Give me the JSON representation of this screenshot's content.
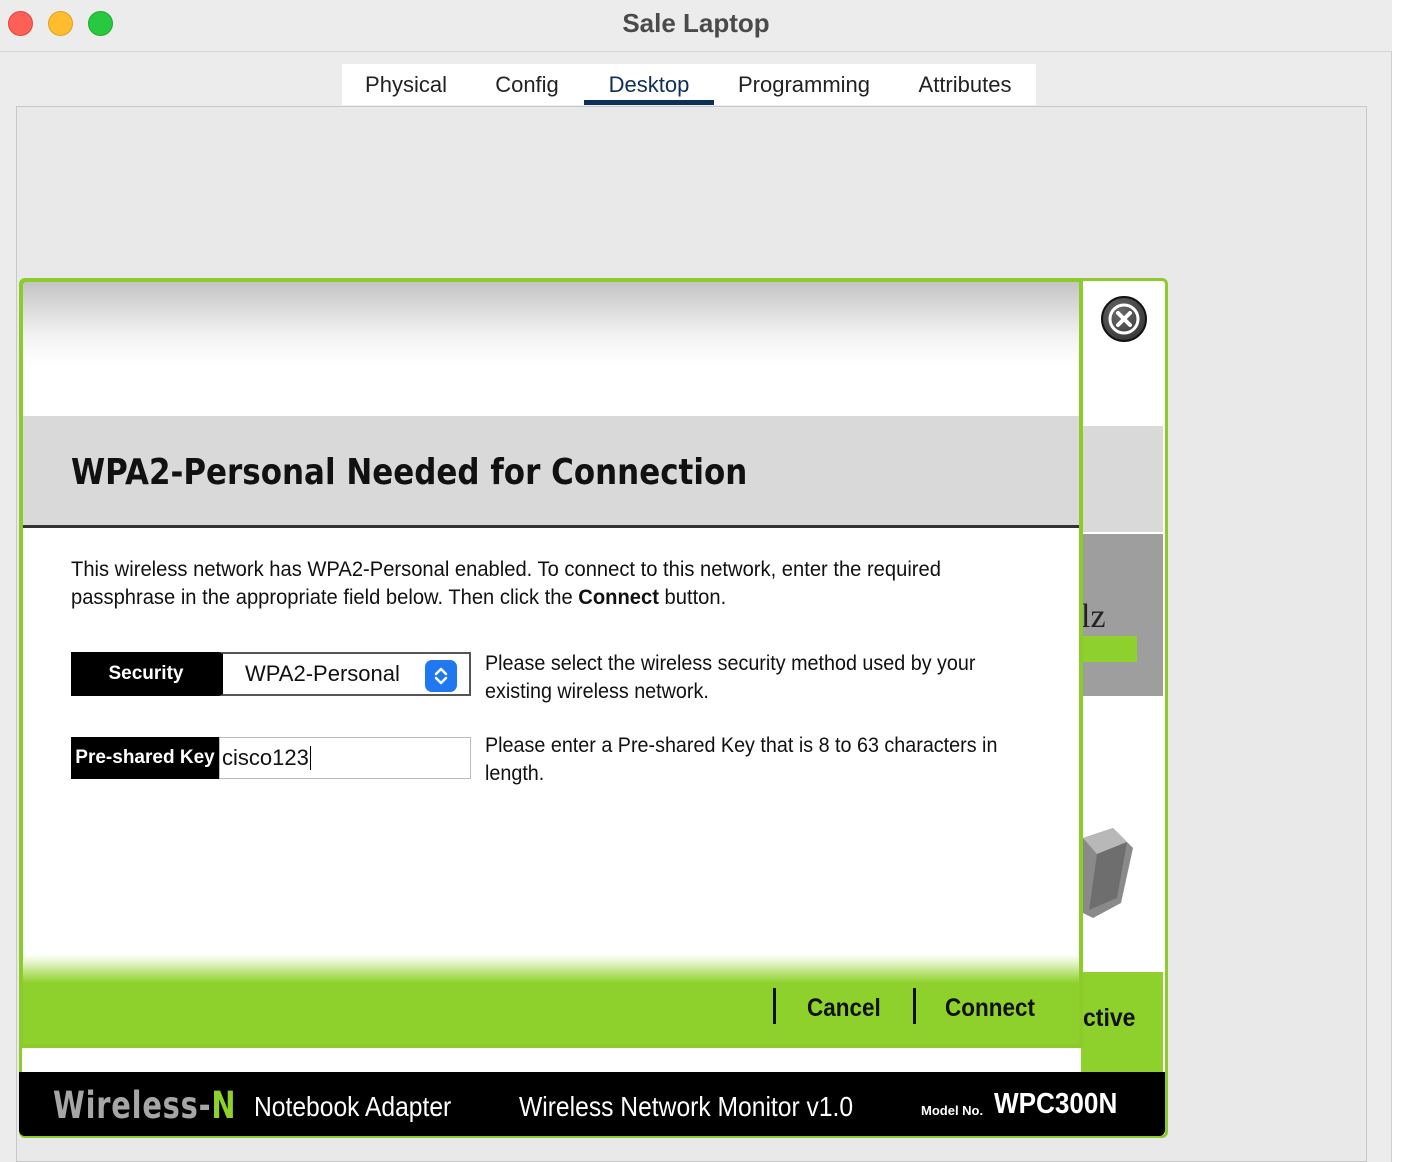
{
  "window": {
    "title": "Sale Laptop"
  },
  "tabs": [
    {
      "label": "Physical"
    },
    {
      "label": "Config"
    },
    {
      "label": "Desktop"
    },
    {
      "label": "Programming"
    },
    {
      "label": "Attributes"
    }
  ],
  "active_tab": "Desktop",
  "dialog": {
    "title": "WPA2-Personal Needed for Connection",
    "description_part1": "This wireless network has WPA2-Personal enabled. To connect to this network, enter the required passphrase in the appropriate field below. Then click the ",
    "description_bold": "Connect",
    "description_part2": " button.",
    "security": {
      "label": "Security",
      "value": "WPA2-Personal",
      "help": "Please select the wireless security method used by your existing wireless network."
    },
    "psk": {
      "label": "Pre-shared Key",
      "value": "cisco123",
      "help": "Please enter a Pre-shared Key that is 8 to 63 characters in length."
    },
    "cancel_label": "Cancel",
    "connect_label": "Connect"
  },
  "background_app": {
    "partial_label": "ctive",
    "partial_text": "lz"
  },
  "footer": {
    "brand_main": "Wireless-",
    "brand_accent": "N",
    "product": "Notebook Adapter",
    "monitor": "Wireless Network Monitor  v1.0",
    "model_label": "Model No.",
    "model": "WPC300N"
  },
  "colors": {
    "accent_green": "#8fd12c",
    "active_tab": "#0e2f57",
    "select_arrow": "#1f78f0"
  },
  "icons": [
    "close-circle-icon",
    "updown-chevron-icon",
    "adapter-device-icon"
  ]
}
